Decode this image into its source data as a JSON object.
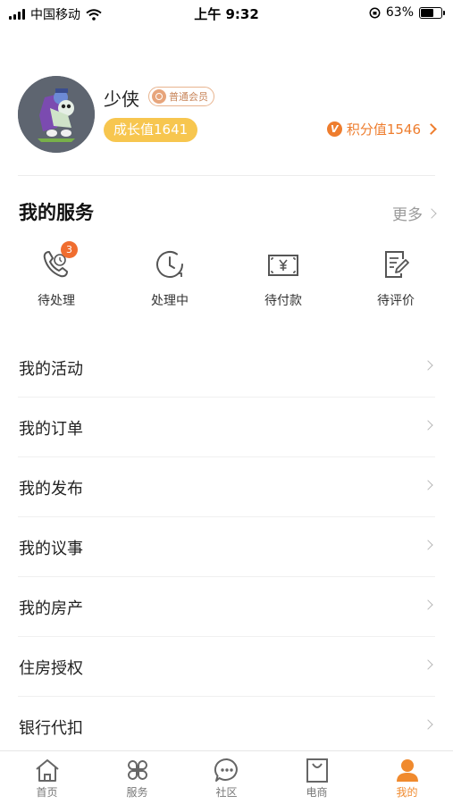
{
  "status_bar": {
    "carrier": "中国移动",
    "time": "上午 9:32",
    "battery": "63%",
    "battery_level": 0.63
  },
  "profile": {
    "username": "少侠",
    "member_level": "普通会员",
    "growth_label": "成长值1641",
    "points_label": "积分值1546",
    "points_icon_letter": "V"
  },
  "services": {
    "title": "我的服务",
    "more_label": "更多",
    "items": [
      {
        "label": "待处理",
        "icon": "phone-clock-icon",
        "badge": "3"
      },
      {
        "label": "处理中",
        "icon": "clock-icon"
      },
      {
        "label": "待付款",
        "icon": "yen-bill-icon"
      },
      {
        "label": "待评价",
        "icon": "document-edit-icon"
      }
    ]
  },
  "menu": [
    {
      "label": "我的活动"
    },
    {
      "label": "我的订单"
    },
    {
      "label": "我的发布"
    },
    {
      "label": "我的议事"
    },
    {
      "label": "我的房产"
    },
    {
      "label": "住房授权"
    },
    {
      "label": "银行代扣"
    }
  ],
  "tabbar": {
    "items": [
      {
        "label": "首页",
        "icon": "home-icon"
      },
      {
        "label": "服务",
        "icon": "grid-icon"
      },
      {
        "label": "社区",
        "icon": "chat-icon"
      },
      {
        "label": "电商",
        "icon": "shopping-bag-icon"
      },
      {
        "label": "我的",
        "icon": "person-icon",
        "active": true
      }
    ]
  },
  "colors": {
    "accent": "#f08a2e",
    "growth_bg": "#f7c64f",
    "badge": "#f06d2f"
  }
}
